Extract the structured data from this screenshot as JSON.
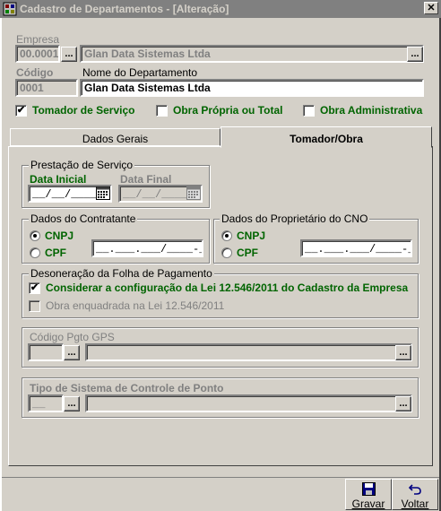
{
  "window": {
    "title": "Cadastro de Departamentos - [Alteração]",
    "close": "✕"
  },
  "empresa": {
    "label": "Empresa",
    "code": "00.0001",
    "name": "Glan Data Sistemas Ltda",
    "lookup": "..."
  },
  "codigo": {
    "label": "Código",
    "value": "0001"
  },
  "nome_departamento": {
    "label": "Nome do Departamento",
    "value": "Glan Data Sistemas Ltda"
  },
  "options": {
    "tomador": {
      "label": "Tomador de Serviço",
      "checked": true
    },
    "obra_propria": {
      "label": "Obra Própria ou Total",
      "checked": false
    },
    "obra_admin": {
      "label": "Obra Administrativa",
      "checked": false
    }
  },
  "tabs": [
    {
      "label": "Dados Gerais",
      "active": false
    },
    {
      "label": "Tomador/Obra",
      "active": true
    }
  ],
  "prestacao": {
    "title": "Prestação de Serviço",
    "data_inicial": {
      "label": "Data Inicial",
      "value": "__/__/____"
    },
    "data_final": {
      "label": "Data Final",
      "value": "__/__/____"
    }
  },
  "contratante": {
    "title": "Dados do Contratante",
    "cnpj": "CNPJ",
    "cpf": "CPF",
    "selected": "CNPJ",
    "value": "__.___.___/____-__"
  },
  "proprietario": {
    "title": "Dados do Proprietário do CNO",
    "cnpj": "CNPJ",
    "cpf": "CPF",
    "selected": "CNPJ",
    "value": "__.___.___/____-__"
  },
  "desoneracao": {
    "title": "Desoneração da Folha de Pagamento",
    "considerar": {
      "label": "Considerar a configuração da Lei 12.546/2011 do Cadastro da Empresa",
      "checked": true
    },
    "enquadrada": {
      "label": "Obra enquadrada na Lei 12.546/2011",
      "checked": false
    }
  },
  "gps": {
    "title": "Código Pgto GPS",
    "lookup": "..."
  },
  "ponto": {
    "title": "Tipo de Sistema de Controle de Ponto",
    "code": "__",
    "lookup": "..."
  },
  "footer": {
    "gravar": {
      "label": "Gravar",
      "icon": "floppy-icon"
    },
    "voltar": {
      "label": "Voltar",
      "icon": "undo-icon"
    }
  }
}
